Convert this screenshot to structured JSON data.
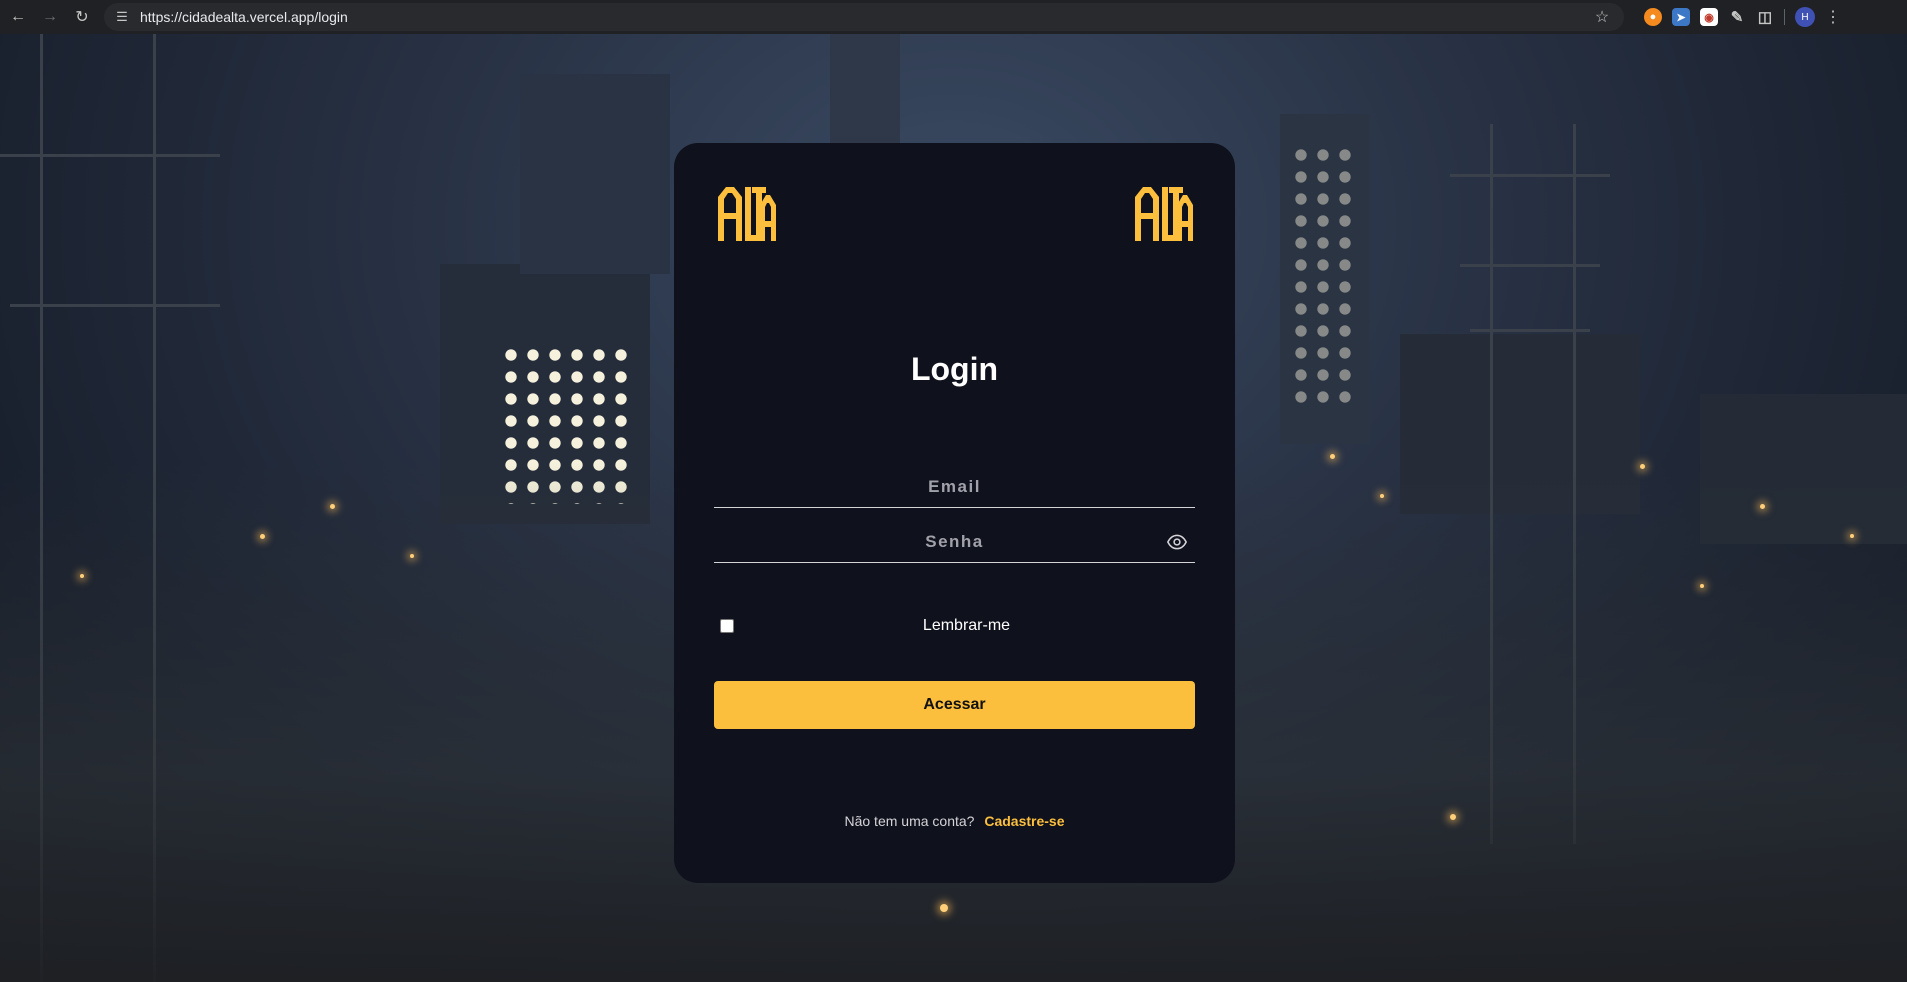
{
  "browser": {
    "url": "https://cidadealta.vercel.app/login",
    "avatar_initial": "H"
  },
  "login": {
    "logo_text": "ALTA",
    "title": "Login",
    "email_placeholder": "Email",
    "password_placeholder": "Senha",
    "remember_label": "Lembrar-me",
    "submit_label": "Acessar",
    "signup_prompt": "Não tem uma conta?",
    "signup_link": "Cadastre-se"
  },
  "colors": {
    "accent": "#fbbf3d",
    "card_bg": "#0f111c",
    "text": "#ffffff"
  },
  "icons": {
    "logo": "alta-logo-icon",
    "password_toggle": "eye-icon",
    "back": "arrow-left-icon",
    "forward": "arrow-right-icon",
    "reload": "reload-icon",
    "bookmark": "star-icon"
  }
}
